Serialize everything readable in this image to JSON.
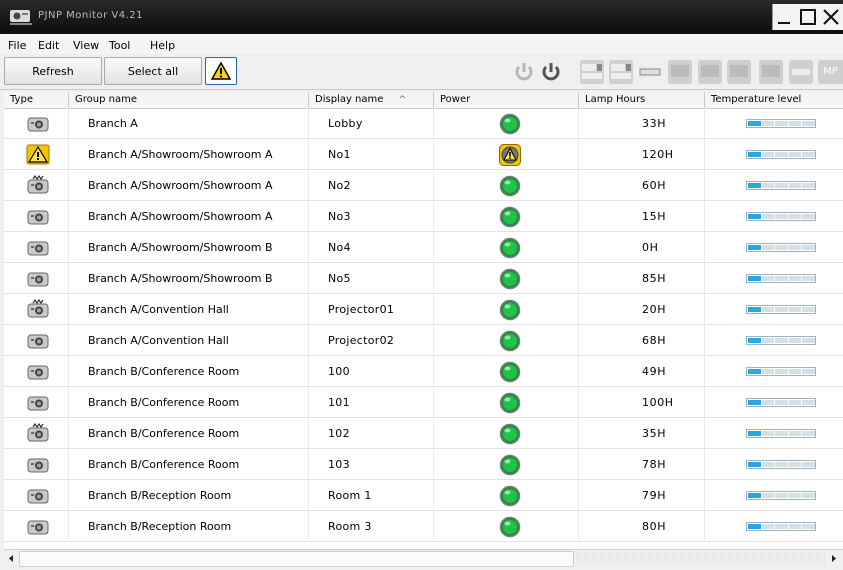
{
  "window": {
    "title": "PJNP Monitor V4.21"
  },
  "menu": [
    "File",
    "Edit",
    "View",
    "Tool",
    "Help"
  ],
  "toolbar": {
    "refresh_label": "Refresh",
    "select_all_label": "Select all",
    "mp_label": "MP"
  },
  "columns": [
    "Type",
    "Group name",
    "Display name",
    "Power",
    "Lamp Hours",
    "Temperature level"
  ],
  "sort_indicator": "^",
  "temperature_bar_colors": {
    "fill": "#27a8e0",
    "empty": "#d6dee6"
  },
  "rows": [
    {
      "type_icon": "projector-icon",
      "group": "Branch A",
      "display": "Lobby",
      "power": "on",
      "lamp": "33H",
      "temp_level": 1
    },
    {
      "type_icon": "warning-icon",
      "group": "Branch A/Showroom/Showroom A",
      "display": "No1",
      "power": "warning",
      "lamp": "120H",
      "temp_level": 1
    },
    {
      "type_icon": "projector-lan-icon",
      "group": "Branch A/Showroom/Showroom A",
      "display": "No2",
      "power": "on",
      "lamp": "60H",
      "temp_level": 1
    },
    {
      "type_icon": "projector-icon",
      "group": "Branch A/Showroom/Showroom A",
      "display": "No3",
      "power": "on",
      "lamp": "15H",
      "temp_level": 1
    },
    {
      "type_icon": "projector-icon",
      "group": "Branch A/Showroom/Showroom B",
      "display": "No4",
      "power": "on",
      "lamp": "0H",
      "temp_level": 1
    },
    {
      "type_icon": "projector-icon",
      "group": "Branch A/Showroom/Showroom B",
      "display": "No5",
      "power": "on",
      "lamp": "85H",
      "temp_level": 1
    },
    {
      "type_icon": "projector-lan-icon",
      "group": "Branch A/Convention Hall",
      "display": "Projector01",
      "power": "on",
      "lamp": "20H",
      "temp_level": 1
    },
    {
      "type_icon": "projector-icon",
      "group": "Branch A/Convention Hall",
      "display": "Projector02",
      "power": "on",
      "lamp": "68H",
      "temp_level": 1
    },
    {
      "type_icon": "projector-icon",
      "group": "Branch B/Conference Room",
      "display": "100",
      "power": "on",
      "lamp": "49H",
      "temp_level": 1
    },
    {
      "type_icon": "projector-icon",
      "group": "Branch B/Conference Room",
      "display": "101",
      "power": "on",
      "lamp": "100H",
      "temp_level": 1
    },
    {
      "type_icon": "projector-lan-icon",
      "group": "Branch B/Conference Room",
      "display": "102",
      "power": "on",
      "lamp": "35H",
      "temp_level": 1
    },
    {
      "type_icon": "projector-icon",
      "group": "Branch B/Conference Room",
      "display": "103",
      "power": "on",
      "lamp": "78H",
      "temp_level": 1
    },
    {
      "type_icon": "projector-icon",
      "group": "Branch B/Reception Room",
      "display": "Room 1",
      "power": "on",
      "lamp": "79H",
      "temp_level": 1
    },
    {
      "type_icon": "projector-icon",
      "group": "Branch B/Reception Room",
      "display": "Room 3",
      "power": "on",
      "lamp": "80H",
      "temp_level": 1
    }
  ]
}
